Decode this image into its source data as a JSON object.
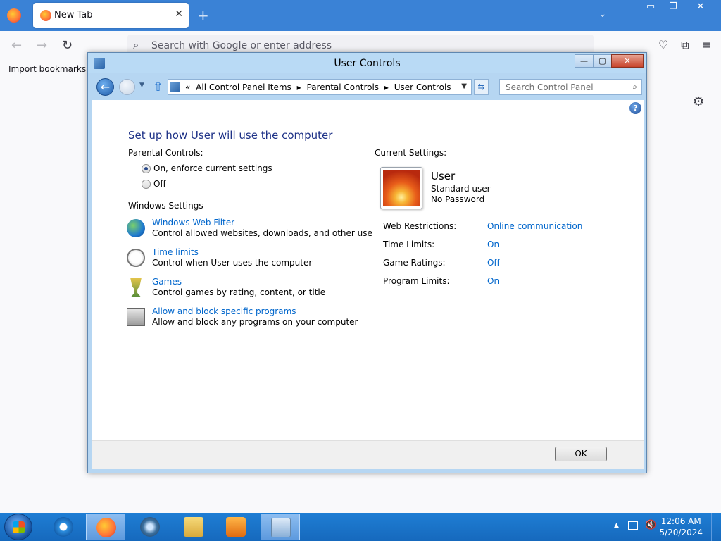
{
  "firefox": {
    "tab_title": "New Tab",
    "tab_close": "✕",
    "new_tab": "+",
    "list_tabs": "⌄",
    "url_placeholder": "Search with Google or enter address",
    "bookmark": "Import bookmarks...",
    "window_controls": [
      "▭",
      "❐",
      "✕"
    ]
  },
  "window": {
    "title": "User Controls",
    "buttons": {
      "minimize": "—",
      "maximize": "▢",
      "close": "✕"
    },
    "breadcrumb": [
      "«",
      "All Control Panel Items",
      "▸",
      "Parental Controls",
      "▸",
      "User Controls"
    ],
    "search_placeholder": "Search Control Panel",
    "help": "?"
  },
  "content": {
    "heading": "Set up how User will use the computer",
    "parental_label": "Parental Controls:",
    "radio_on": "On, enforce current settings",
    "radio_off": "Off",
    "radio_selected": "on",
    "windows_settings_label": "Windows Settings",
    "tasks": [
      {
        "link": "Windows Web Filter",
        "desc": "Control allowed websites, downloads, and other use",
        "icon": "globe-icon"
      },
      {
        "link": "Time limits",
        "desc": "Control when User uses the computer",
        "icon": "stopwatch-icon"
      },
      {
        "link": "Games",
        "desc": "Control games by rating, content, or title",
        "icon": "trophy-icon"
      },
      {
        "link": "Allow and block specific programs",
        "desc": "Allow and block any programs on your computer",
        "icon": "programs-icon"
      }
    ],
    "current_settings_label": "Current Settings:",
    "user": {
      "name": "User",
      "type": "Standard user",
      "password": "No Password"
    },
    "settings": [
      {
        "label": "Web Restrictions:",
        "value": "Online communication"
      },
      {
        "label": "Time Limits:",
        "value": "On"
      },
      {
        "label": "Game Ratings:",
        "value": "Off"
      },
      {
        "label": "Program Limits:",
        "value": "On"
      }
    ],
    "ok": "OK"
  },
  "taskbar": {
    "time": "12:06 AM",
    "date": "5/20/2024"
  },
  "colors": {
    "link": "#0066cc",
    "heading": "#1e3287",
    "taskbar": "#1669bd"
  }
}
